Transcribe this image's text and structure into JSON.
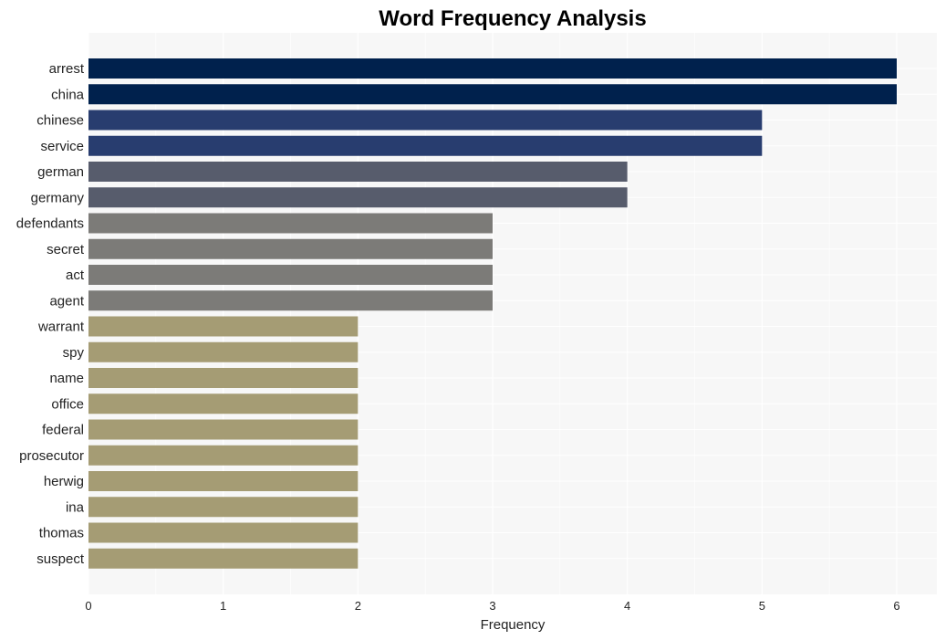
{
  "chart_data": {
    "type": "bar",
    "orientation": "horizontal",
    "title": "Word Frequency Analysis",
    "xlabel": "Frequency",
    "ylabel": "",
    "xlim": [
      0,
      6.3
    ],
    "xticks": [
      0,
      1,
      2,
      3,
      4,
      5,
      6
    ],
    "grid": true,
    "categories": [
      "arrest",
      "china",
      "chinese",
      "service",
      "german",
      "germany",
      "defendants",
      "secret",
      "act",
      "agent",
      "warrant",
      "spy",
      "name",
      "office",
      "federal",
      "prosecutor",
      "herwig",
      "ina",
      "thomas",
      "suspect"
    ],
    "values": [
      6,
      6,
      5,
      5,
      4,
      4,
      3,
      3,
      3,
      3,
      2,
      2,
      2,
      2,
      2,
      2,
      2,
      2,
      2,
      2
    ],
    "colors_by_value": {
      "6": "#00214d",
      "5": "#283d6f",
      "4": "#575c6c",
      "3": "#7c7b78",
      "2": "#a59c74"
    },
    "background": "#f7f7f7"
  }
}
